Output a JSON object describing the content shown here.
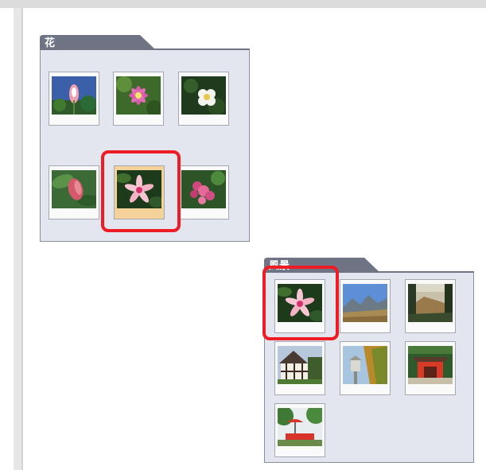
{
  "folders": [
    {
      "label": "花",
      "photos": [
        {
          "icon": "flower-photo-icon",
          "selected": false
        },
        {
          "icon": "flower-photo-icon",
          "selected": false
        },
        {
          "icon": "flower-photo-icon",
          "selected": false
        },
        {
          "icon": "flower-photo-icon",
          "selected": false
        },
        {
          "icon": "lily-photo-icon",
          "selected": true
        },
        {
          "icon": "flower-photo-icon",
          "selected": false
        }
      ]
    },
    {
      "label": "風景",
      "photos": [
        {
          "icon": "lily-photo-icon",
          "selected": false
        },
        {
          "icon": "mountain-photo-icon",
          "selected": false
        },
        {
          "icon": "landscape-photo-icon",
          "selected": false
        },
        {
          "icon": "house-photo-icon",
          "selected": false
        },
        {
          "icon": "lantern-photo-icon",
          "selected": false
        },
        {
          "icon": "shrine-photo-icon",
          "selected": false
        },
        {
          "icon": "garden-photo-icon",
          "selected": false
        }
      ]
    }
  ],
  "colors": {
    "highlight": "#ee1c24",
    "folder_body": "#e3e6ee",
    "folder_tab": "#6f7485",
    "selected": "#f6d29b"
  }
}
